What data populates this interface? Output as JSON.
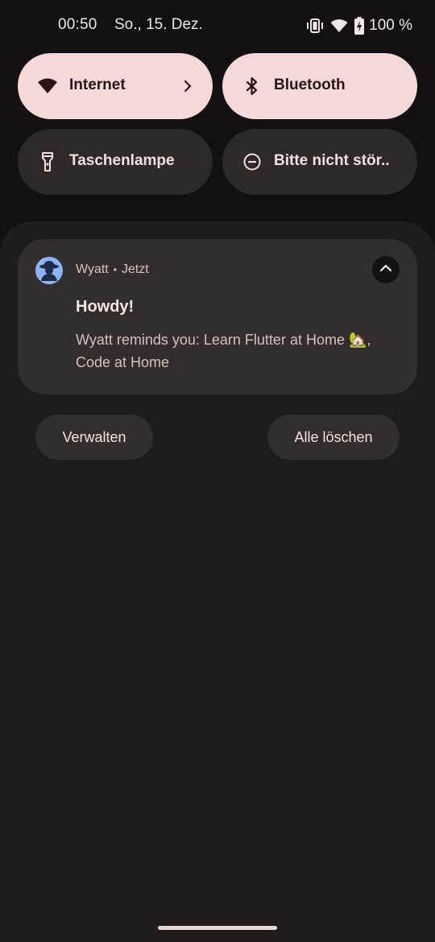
{
  "status_bar": {
    "time": "00:50",
    "date": "So., 15. Dez.",
    "battery": "100 %",
    "icons": [
      "vibrate-icon",
      "wifi-icon",
      "battery-charging-icon"
    ]
  },
  "quick_settings": {
    "tiles": [
      {
        "label": "Internet",
        "icon": "wifi-icon",
        "state": "active",
        "chevron": true
      },
      {
        "label": "Bluetooth",
        "icon": "bluetooth-icon",
        "state": "active"
      },
      {
        "label": "Taschenlampe",
        "icon": "flashlight-icon",
        "state": "inactive"
      },
      {
        "label": "Bitte nicht stör..",
        "icon": "do-not-disturb-icon",
        "state": "inactive"
      }
    ]
  },
  "notification": {
    "app_name": "Wyatt",
    "separator": "•",
    "time": "Jetzt",
    "title": "Howdy!",
    "body": "Wyatt reminds you: Learn Flutter at Home 🏡, Code at Home",
    "icon": "detective-avatar-icon",
    "expand_icon": "chevron-up-icon"
  },
  "actions": {
    "manage": "Verwalten",
    "clear_all": "Alle löschen"
  },
  "colors": {
    "background": "#140f10",
    "shade": "#221b1c",
    "card": "#342d2e",
    "tile_active": "#f5d8da",
    "tile_inactive": "#2f2829",
    "avatar": "#8ab4f8"
  }
}
